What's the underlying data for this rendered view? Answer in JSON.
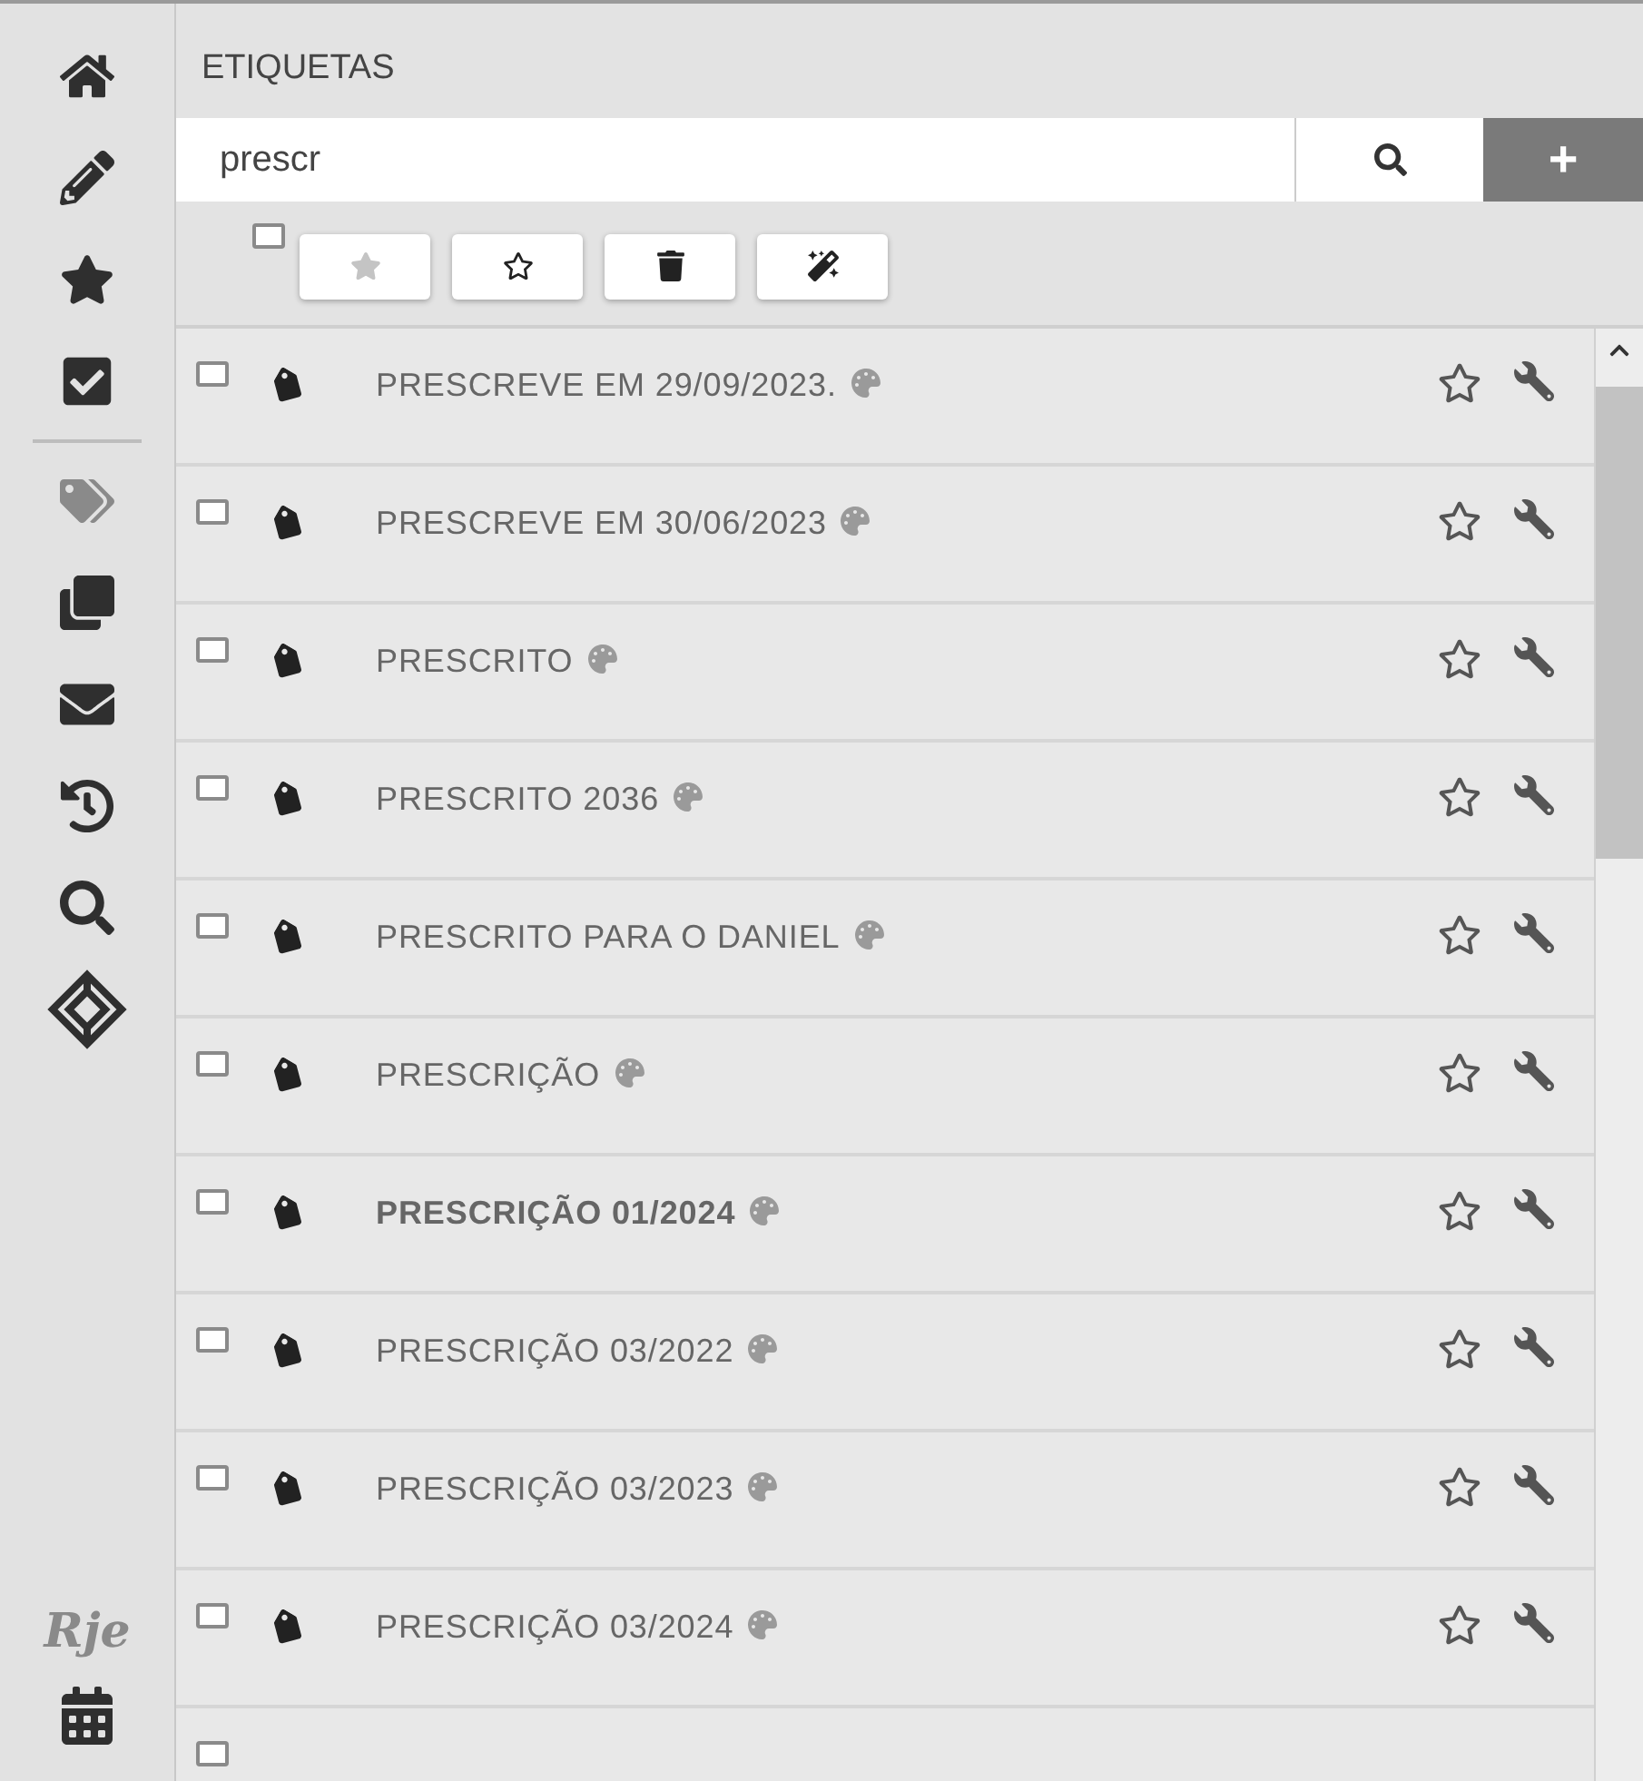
{
  "sidebar": {
    "items": [
      {
        "kind": "home",
        "selected": false
      },
      {
        "kind": "pencil",
        "selected": false
      },
      {
        "kind": "star",
        "selected": false
      },
      {
        "kind": "check",
        "selected": false
      },
      {
        "kind": "divider"
      },
      {
        "kind": "tags",
        "selected": true
      },
      {
        "kind": "clone",
        "selected": false
      },
      {
        "kind": "envelope",
        "selected": false
      },
      {
        "kind": "history",
        "selected": false
      },
      {
        "kind": "search",
        "selected": false
      },
      {
        "kind": "diamond",
        "selected": false
      }
    ],
    "logo": "Rje"
  },
  "title": "ETIQUETAS",
  "search": {
    "value": "prescr",
    "add_label": "+"
  },
  "select_all": {
    "checked": false
  },
  "toolbar": [
    {
      "kind": "star",
      "disabled": true
    },
    {
      "kind": "star-outline",
      "disabled": false
    },
    {
      "kind": "trash",
      "disabled": false
    },
    {
      "kind": "magic",
      "disabled": false
    }
  ],
  "rows": [
    {
      "label": "PRESCREVE EM 29/09/2023.",
      "bold": false,
      "checked": false,
      "favorite": false
    },
    {
      "label": "PRESCREVE EM 30/06/2023",
      "bold": false,
      "checked": false,
      "favorite": false
    },
    {
      "label": "PRESCRITO",
      "bold": false,
      "checked": false,
      "favorite": false
    },
    {
      "label": "PRESCRITO 2036",
      "bold": false,
      "checked": false,
      "favorite": false
    },
    {
      "label": "PRESCRITO PARA O DANIEL",
      "bold": false,
      "checked": false,
      "favorite": false
    },
    {
      "label": "PRESCRIÇÃO",
      "bold": false,
      "checked": false,
      "favorite": false
    },
    {
      "label": "PRESCRIÇÃO 01/2024",
      "bold": true,
      "checked": false,
      "favorite": false
    },
    {
      "label": "PRESCRIÇÃO 03/2022",
      "bold": false,
      "checked": false,
      "favorite": false
    },
    {
      "label": "PRESCRIÇÃO 03/2023",
      "bold": false,
      "checked": false,
      "favorite": false
    },
    {
      "label": "PRESCRIÇÃO 03/2024",
      "bold": false,
      "checked": false,
      "favorite": false
    }
  ],
  "partial_row": {
    "checked": false
  }
}
